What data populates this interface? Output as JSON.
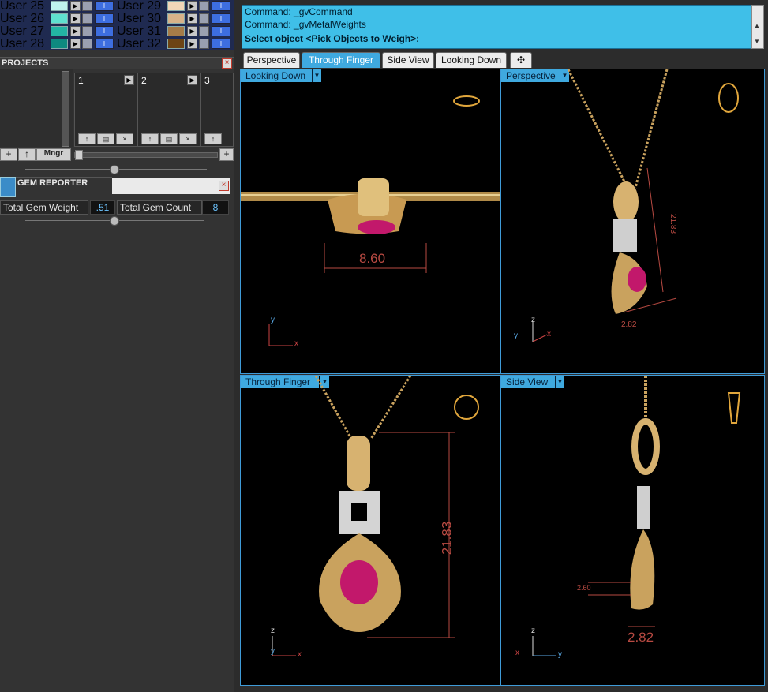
{
  "layers": [
    {
      "name": "User 25",
      "color": "#bff4ef"
    },
    {
      "name": "User 29",
      "color": "#f1d6b8"
    },
    {
      "name": "User 26",
      "color": "#5fe0cf"
    },
    {
      "name": "User 30",
      "color": "#d7b389"
    },
    {
      "name": "User 27",
      "color": "#23b4a4"
    },
    {
      "name": "User 31",
      "color": "#a57b48"
    },
    {
      "name": "User 28",
      "color": "#0e8a80"
    },
    {
      "name": "User 32",
      "color": "#6d4414"
    }
  ],
  "projects": {
    "title": "PROJECTS",
    "slots": [
      "1",
      "2",
      "3"
    ],
    "buttons": {
      "add": "+",
      "up": "↑",
      "mngr": "Mngr",
      "plus": "+"
    }
  },
  "gem_reporter": {
    "title": "GEM REPORTER",
    "weight_label": "Total Gem Weight",
    "weight_value": ".51",
    "count_label": "Total Gem Count",
    "count_value": "8"
  },
  "command": {
    "line1": "Command: _gvCommand",
    "line2": "Command: _gvMetalWeights",
    "prompt": "Select object <Pick Objects to Weigh>:"
  },
  "tabs": [
    "Perspective",
    "Through Finger",
    "Side View",
    "Looking Down",
    "✣"
  ],
  "viewports": {
    "tl": {
      "label": "Looking Down",
      "dim": "8.60",
      "axis_y": "y",
      "axis_x": "x"
    },
    "tr": {
      "label": "Perspective",
      "dim1": "21.83",
      "dim2": "2.82",
      "axis_z": "z",
      "axis_y": "y",
      "axis_x": "x"
    },
    "bl": {
      "label": "Through Finger",
      "dim": "21.83",
      "axis_z": "z",
      "axis_y": "y",
      "axis_x": "x"
    },
    "br": {
      "label": "Side View",
      "dim1": "2.82",
      "dim2": "2.60",
      "axis_z": "z",
      "axis_x": "x",
      "axis_y": "y"
    }
  }
}
